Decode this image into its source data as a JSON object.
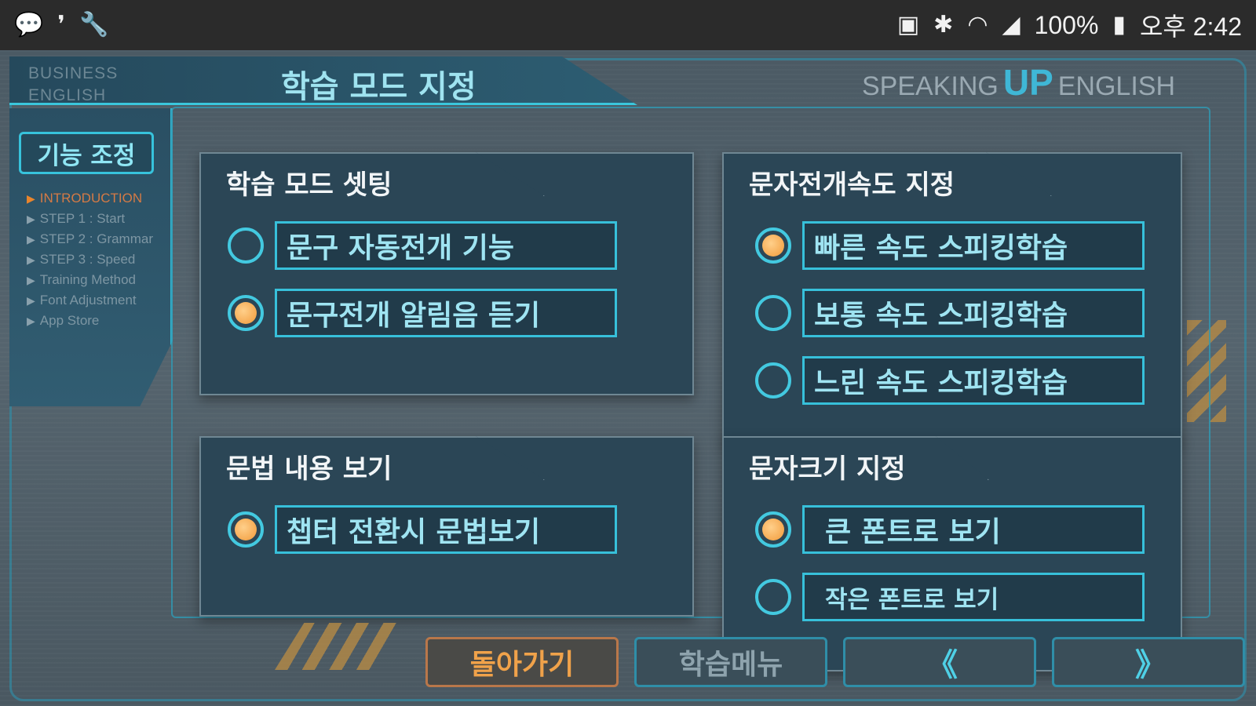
{
  "status_bar": {
    "left_icons": [
      "chat-icon",
      "notification-icon",
      "wrench-icon"
    ],
    "right_icons": [
      "battery-saver-icon",
      "bluetooth-icon",
      "wifi-icon",
      "signal-icon"
    ],
    "battery": "100%",
    "time": "오후 2:42"
  },
  "header": {
    "logo_line1": "BUSINESS",
    "logo_line2": "ENGLISH",
    "title": "학습 모드 지정",
    "brand_left": "SPEAKING",
    "brand_up": "UP",
    "brand_right": "ENGLISH"
  },
  "sidebar": {
    "heading": "기능 조정",
    "items": [
      {
        "label": "INTRODUCTION",
        "active": true
      },
      {
        "label": "STEP 1 : Start",
        "active": false
      },
      {
        "label": "STEP 2 : Grammar",
        "active": false
      },
      {
        "label": "STEP 3 : Speed",
        "active": false
      },
      {
        "label": "Training Method",
        "active": false
      },
      {
        "label": "Font Adjustment",
        "active": false
      },
      {
        "label": "App Store",
        "active": false
      }
    ]
  },
  "panels": {
    "study_mode": {
      "title": "학습 모드 셋팅",
      "options": [
        {
          "label": "문구 자동전개 기능",
          "selected": false
        },
        {
          "label": "문구전개 알림음 듣기",
          "selected": true
        }
      ]
    },
    "grammar": {
      "title": "문법 내용 보기",
      "options": [
        {
          "label": "챕터 전환시 문법보기",
          "selected": true
        }
      ]
    },
    "text_speed": {
      "title": "문자전개속도 지정",
      "options": [
        {
          "label": "빠른 속도 스피킹학습",
          "selected": true
        },
        {
          "label": "보통 속도 스피킹학습",
          "selected": false
        },
        {
          "label": "느린 속도 스피킹학습",
          "selected": false
        }
      ]
    },
    "text_size": {
      "title": "문자크기 지정",
      "options": [
        {
          "label": "큰 폰트로 보기",
          "selected": true
        },
        {
          "label": "작은 폰트로 보기",
          "selected": false
        }
      ]
    }
  },
  "bottom_buttons": {
    "back": "돌아가기",
    "menu": "학습메뉴",
    "prev": "《",
    "next": "》"
  },
  "colors": {
    "accent_cyan": "#37c0da",
    "accent_orange": "#f19a3a",
    "panel_bg": "#2b4656"
  }
}
